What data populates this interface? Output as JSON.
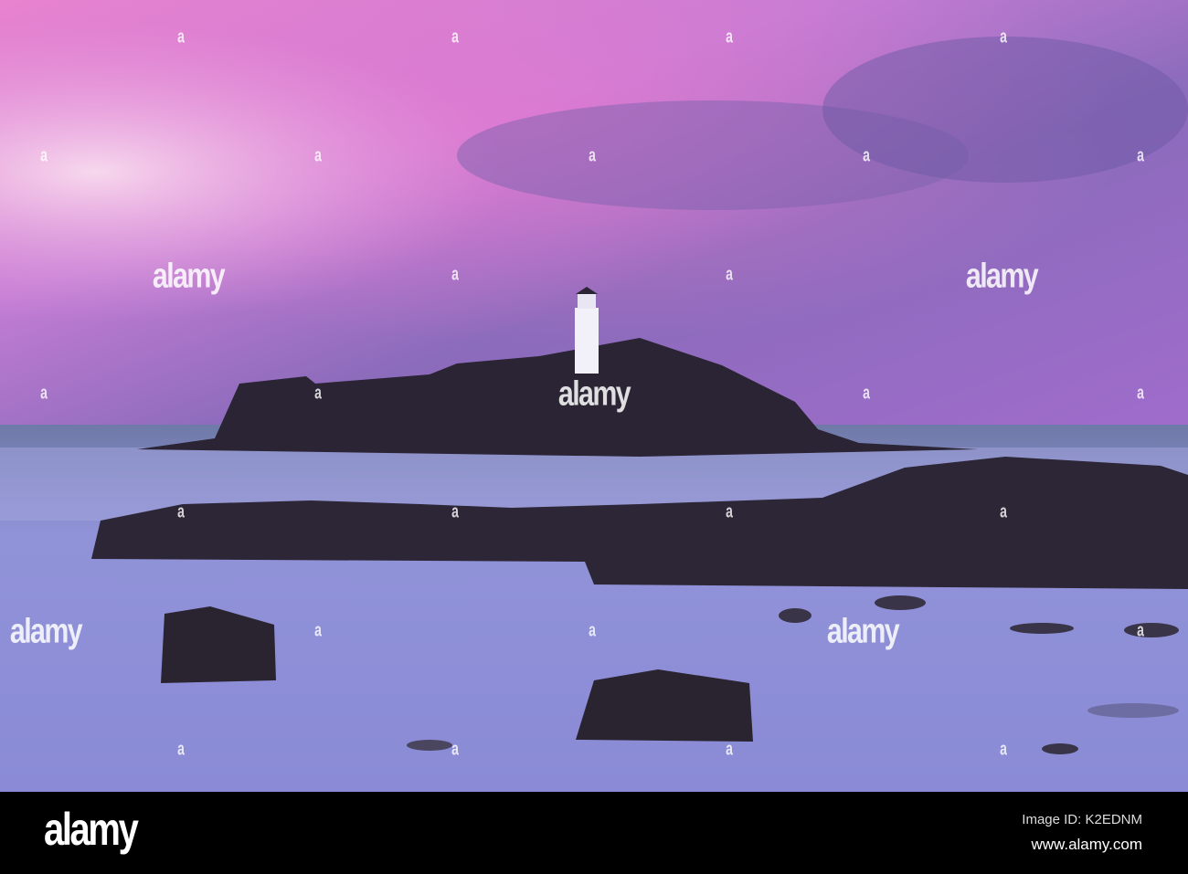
{
  "watermark": {
    "large": "alamy",
    "small": "a"
  },
  "footer": {
    "logo": "alamy",
    "image_id": "Image ID: K2EDNM",
    "url": "www.alamy.com"
  },
  "colors": {
    "sky_pink": "#e07ad0",
    "sky_purple": "#8a68b8",
    "sea": "#8e8fd8",
    "rock": "#26202e"
  }
}
